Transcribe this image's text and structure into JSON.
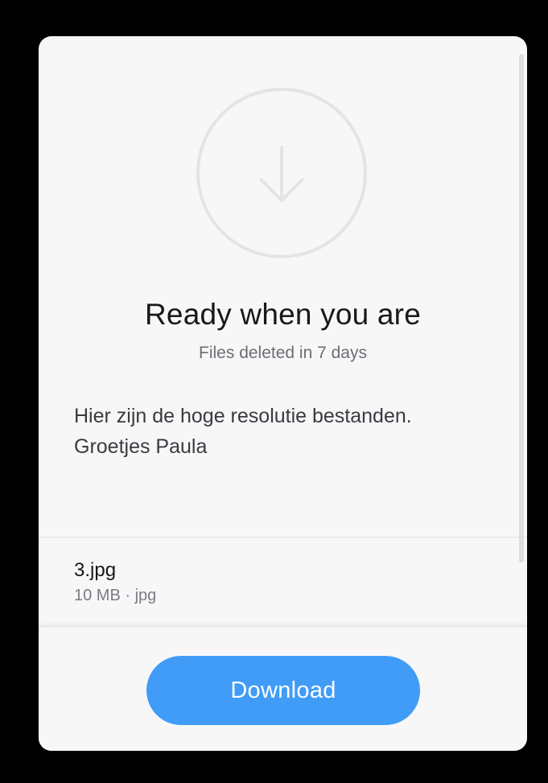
{
  "header": {
    "icon": "download-arrow-icon",
    "title": "Ready when you are",
    "subtitle": "Files deleted in 7 days"
  },
  "message": {
    "line1": "Hier zijn de hoge resolutie bestanden.",
    "line2": "Groetjes Paula"
  },
  "files": [
    {
      "name": "3.jpg",
      "size": "10 MB",
      "separator": "·",
      "type": "jpg"
    }
  ],
  "footer": {
    "download_label": "Download"
  },
  "colors": {
    "accent": "#409cf7",
    "card_background": "#f7f7f8",
    "page_background": "#000000",
    "icon_stroke": "#e4e4e7"
  }
}
